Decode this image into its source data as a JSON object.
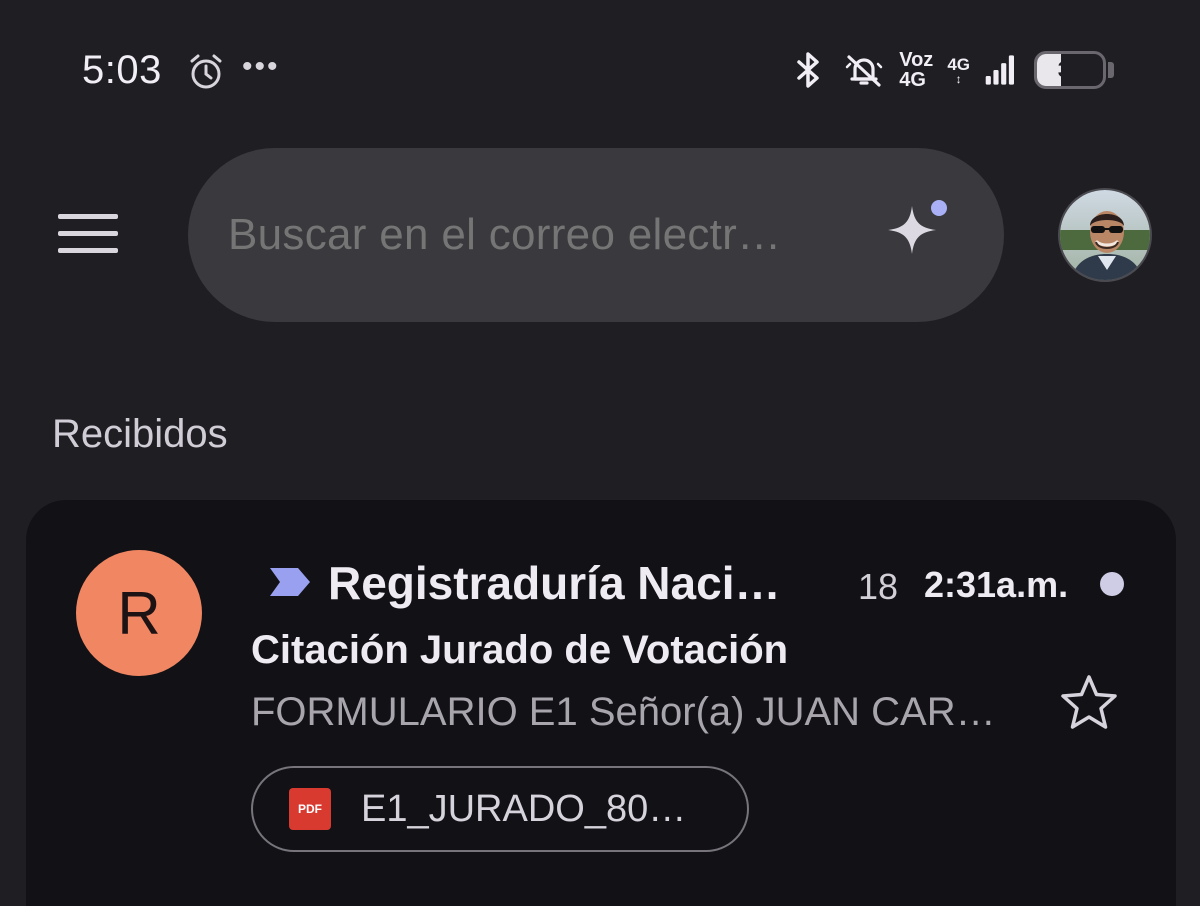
{
  "status_bar": {
    "time": "5:03",
    "more": "•••",
    "network_voz": "Voz",
    "network_4g": "4G",
    "signal_4g": "4G",
    "battery_level": "37",
    "icons": [
      "alarm-icon",
      "bluetooth-icon",
      "bell-off-icon",
      "signal-icon",
      "battery-icon"
    ]
  },
  "top_bar": {
    "menu_icon": "hamburger-menu-icon",
    "search_placeholder": "Buscar en el correo electr…",
    "assistant_icon": "sparkle-icon"
  },
  "section": {
    "title": "Recibidos"
  },
  "emails": [
    {
      "avatar_letter": "R",
      "avatar_color": "#f08662",
      "importance_marker": "important-icon",
      "sender": "Registraduría Naci…",
      "thread_count": "18",
      "time": "2:31a.m.",
      "unread": true,
      "subject": "Citación Jurado de Votación",
      "snippet": "FORMULARIO E1 Señor(a) JUAN CAR…",
      "starred": false,
      "attachment": {
        "type_label": "PDF",
        "name": "E1_JURADO_80…"
      }
    }
  ],
  "colors": {
    "background": "#1f1f23",
    "card": "#121216",
    "search": "#3a3a3e",
    "accent": "#9aa0f0",
    "pdf": "#d93a30"
  }
}
